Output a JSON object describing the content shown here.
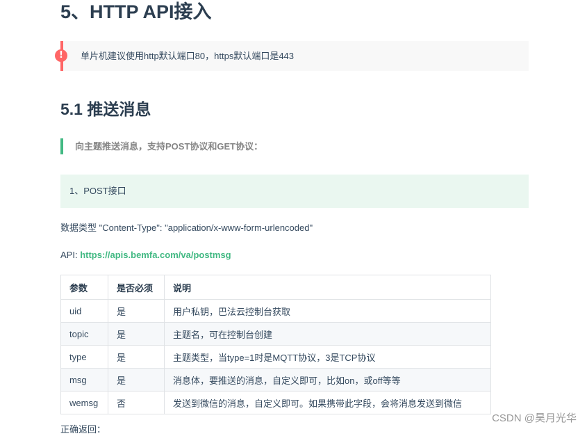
{
  "section": {
    "title": "5、HTTP API接入",
    "warning_icon": "!",
    "warning_text": "单片机建议使用http默认端口80，https默认端口是443"
  },
  "subsection": {
    "title": "5.1 推送消息",
    "quote": "向主题推送消息，支持POST协议和GET协议：",
    "tip": "1、POST接口",
    "content_type": "数据类型 \"Content-Type\": \"application/x-www-form-urlencoded\"",
    "api_label": "API: ",
    "api_url": "https://apis.bemfa.com/va/postmsg",
    "return_label": "正确返回："
  },
  "table": {
    "headers": [
      "参数",
      "是否必须",
      "说明"
    ],
    "rows": [
      [
        "uid",
        "是",
        "用户私钥，巴法云控制台获取"
      ],
      [
        "topic",
        "是",
        "主题名，可在控制台创建"
      ],
      [
        "type",
        "是",
        "主题类型，当type=1时是MQTT协议，3是TCP协议"
      ],
      [
        "msg",
        "是",
        "消息体，要推送的消息，自定义即可，比如on，或off等等"
      ],
      [
        "wemsg",
        "否",
        "发送到微信的消息，自定义即可。如果携带此字段，会将消息发送到微信"
      ]
    ]
  },
  "watermark": "CSDN @昊月光华",
  "colors": {
    "warning": "#ff6666",
    "accent": "#42b983",
    "tip_background": "#eaf7f0"
  }
}
